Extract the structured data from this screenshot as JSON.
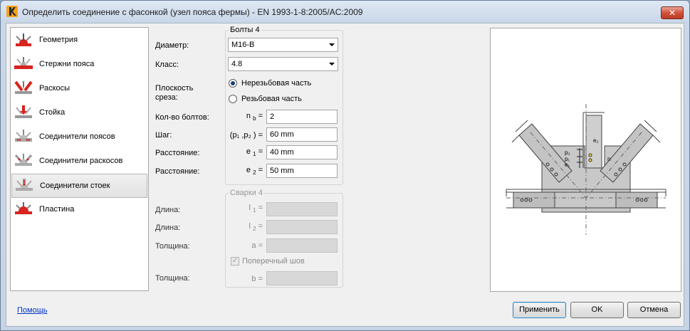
{
  "window": {
    "title": "Определить соединение с фасонкой (узел пояса фермы) - EN 1993-1-8:2005/AC:2009",
    "close_symbol": "✕"
  },
  "sidebar": {
    "items": [
      {
        "label": "Геометрия",
        "icon": "geometry-icon"
      },
      {
        "label": "Стержни пояса",
        "icon": "chord-members-icon"
      },
      {
        "label": "Раскосы",
        "icon": "diagonals-icon"
      },
      {
        "label": "Стойка",
        "icon": "post-icon"
      },
      {
        "label": "Соединители поясов",
        "icon": "chord-connectors-icon"
      },
      {
        "label": "Соединители раскосов",
        "icon": "diagonal-connectors-icon"
      },
      {
        "label": "Соединители стоек",
        "icon": "post-connectors-icon"
      },
      {
        "label": "Пластина",
        "icon": "plate-icon"
      }
    ],
    "selected_index": 6
  },
  "bolts": {
    "group_title": "Болты 4",
    "diameter_label": "Диаметр:",
    "diameter_value": "M16-B",
    "class_label": "Класс:",
    "class_value": "4.8",
    "shear_plane_label_1": "Плоскость",
    "shear_plane_label_2": "среза:",
    "shear_option_unthreaded": "Нерезьбовая часть",
    "shear_option_threaded": "Резьбовая часть",
    "shear_selected": "Нерезьбовая часть",
    "count_label": "Кол-во болтов:",
    "count_sym_main": "n",
    "count_sym_sub": "b",
    "count_value": "2",
    "pitch_label": "Шаг:",
    "pitch_sym": "(p₁ ,p₂ ) =",
    "pitch_value": "60 mm",
    "dist1_label": "Расстояние:",
    "dist1_sym_main": "e",
    "dist1_sym_sub": "1",
    "dist1_value": "40 mm",
    "dist2_label": "Расстояние:",
    "dist2_sym_main": "e",
    "dist2_sym_sub": "2",
    "dist2_value": "50 mm"
  },
  "welds": {
    "group_title": "Сварки 4",
    "length1_label": "Длина:",
    "length1_sym_main": "l",
    "length1_sym_sub": "1",
    "length2_label": "Длина:",
    "length2_sym_main": "l",
    "length2_sym_sub": "2",
    "thickness1_label": "Толщина:",
    "thickness1_sym": "a =",
    "transverse_label": "Поперечный шов",
    "transverse_checked": true,
    "thickness2_label": "Толщина:",
    "thickness2_sym": "b ="
  },
  "footer": {
    "help_link": "Помощь",
    "apply_label": "Применить",
    "ok_label": "OK",
    "cancel_label": "Отмена"
  },
  "colors": {
    "accent_red": "#d8231f",
    "selection_border": "#3c7fb1"
  }
}
